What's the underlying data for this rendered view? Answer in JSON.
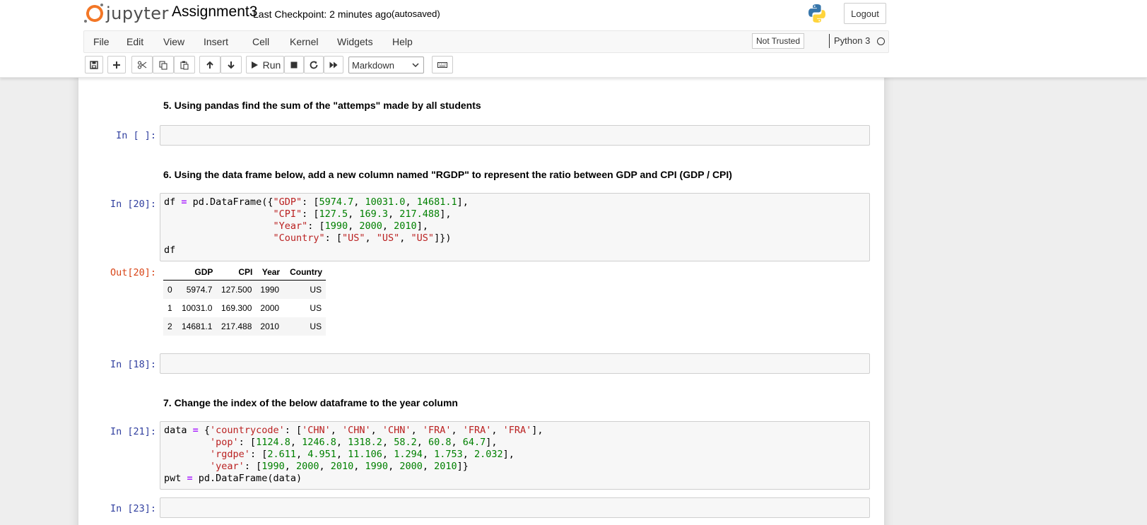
{
  "header": {
    "logo_text": "jupyter",
    "notebook_name": "Assignment3",
    "checkpoint": "Last Checkpoint: 2 minutes ago",
    "autosave": "(autosaved)",
    "logout": "Logout"
  },
  "menu": {
    "items": [
      "File",
      "Edit",
      "View",
      "Insert",
      "Cell",
      "Kernel",
      "Widgets",
      "Help"
    ],
    "trust": "Not Trusted",
    "kernel": "Python 3"
  },
  "toolbar": {
    "run_label": "Run",
    "cell_type": "Markdown",
    "icons": [
      "save-icon",
      "plus-icon",
      "cut-icon",
      "copy-icon",
      "paste-icon",
      "arrow-up-icon",
      "arrow-down-icon",
      "play-icon",
      "stop-icon",
      "restart-icon",
      "fast-forward-icon",
      "keyboard-icon"
    ]
  },
  "cells": {
    "md5": "5. Using pandas find the sum of the \"attemps\" made by all students",
    "in_empty1": "In [ ]:",
    "md6": "6. Using the data frame below, add a new column named \"RGDP\" to represent the ratio between GDP and CPI (GDP / CPI)",
    "in20": "In [20]:",
    "out20": "Out[20]:",
    "in18": "In [18]:",
    "md7": "7. Change the index of the below dataframe to the year column",
    "in21": "In [21]:",
    "in23": "In [23]:"
  },
  "code20": {
    "l1_a": "df ",
    "l1_op": "=",
    "l1_b": " pd.DataFrame({",
    "s_gdp": "\"GDP\"",
    "l1_c": ": [",
    "n1": "5974.7",
    "comma": ", ",
    "n2": "10031.0",
    "n3": "14681.1",
    "l1_end": "],",
    "indent": "                   ",
    "s_cpi": "\"CPI\"",
    "n4": "127.5",
    "n5": "169.3",
    "n6": "217.488",
    "s_year": "\"Year\"",
    "n7": "1990",
    "n8": "2000",
    "n9": "2010",
    "s_country": "\"Country\"",
    "s_us": "\"US\"",
    "l4_end": "]})",
    "l5": "df"
  },
  "df_table": {
    "columns": [
      "",
      "GDP",
      "CPI",
      "Year",
      "Country"
    ],
    "rows": [
      [
        "0",
        "5974.7",
        "127.500",
        "1990",
        "US"
      ],
      [
        "1",
        "10031.0",
        "169.300",
        "2000",
        "US"
      ],
      [
        "2",
        "14681.1",
        "217.488",
        "2010",
        "US"
      ]
    ]
  },
  "code21": {
    "l1_a": "data ",
    "op": "=",
    "l1_b": " {",
    "s_cc": "'countrycode'",
    "colon_br": ": [",
    "s_chn": "'CHN'",
    "s_fra": "'FRA'",
    "comma": ", ",
    "end_line": "],",
    "indent": "        ",
    "s_pop": "'pop'",
    "p1": "1124.8",
    "p2": "1246.8",
    "p3": "1318.2",
    "p4": "58.2",
    "p5": "60.8",
    "p6": "64.7",
    "s_rgdpe": "'rgdpe'",
    "r1": "2.611",
    "r2": "4.951",
    "r3": "11.106",
    "r4": "1.294",
    "r5": "1.753",
    "r6": "2.032",
    "s_year": "'year'",
    "y1": "1990",
    "y2": "2000",
    "y3": "2010",
    "end_last": "]}",
    "l5_a": "pwt ",
    "l5_b": " pd.DataFrame(data)"
  }
}
